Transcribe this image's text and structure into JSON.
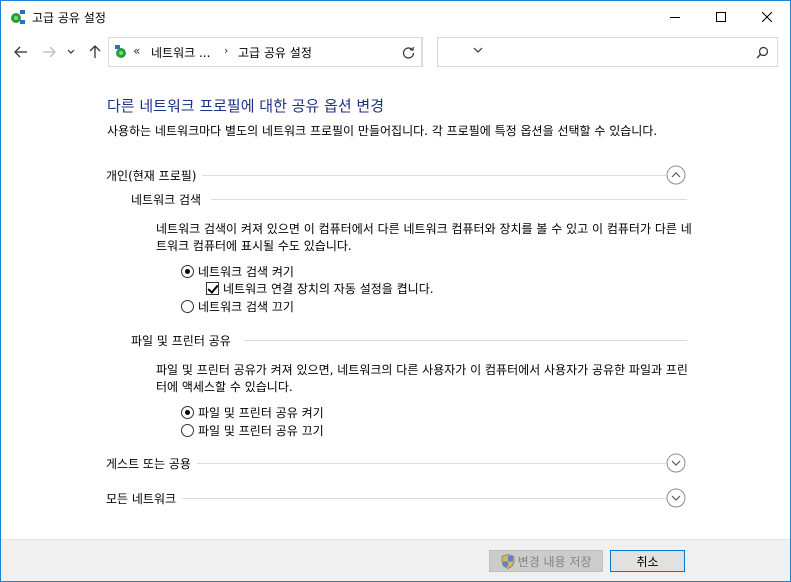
{
  "window": {
    "title": "고급 공유 설정",
    "icon": "network-sharing-icon"
  },
  "address_bar": {
    "overflow": "«",
    "segments": [
      "네트워크 ...",
      "고급 공유 설정"
    ],
    "separator": "›",
    "search_placeholder": ""
  },
  "main": {
    "heading": "다른 네트워크 프로필에 대한 공유 옵션 변경",
    "description": "사용하는 네트워크마다 별도의 네트워크 프로필이 만들어집니다. 각 프로필에 특정 옵션을 선택할 수 있습니다.",
    "private_profile": {
      "label": "개인(현재 프로필)",
      "expanded": true,
      "network_discovery": {
        "title": "네트워크 검색",
        "description": "네트워크 검색이 켜져 있으면 이 컴퓨터에서 다른 네트워크 컴퓨터와 장치를 볼 수 있고 이 컴퓨터가 다른 네트워크 컴퓨터에 표시될 수도 있습니다.",
        "option_on": "네트워크 검색 켜기",
        "option_auto": "네트워크 연결 장치의 자동 설정을 켭니다.",
        "option_off": "네트워크 검색 끄기",
        "selected": "on",
        "auto_setup_checked": true
      },
      "file_printer_sharing": {
        "title": "파일 및 프린터 공유",
        "description": "파일 및 프린터 공유가 켜져 있으면, 네트워크의 다른 사용자가 이 컴퓨터에서 사용자가 공유한 파일과 프린터에 액세스할 수 있습니다.",
        "option_on": "파일 및 프린터 공유 켜기",
        "option_off": "파일 및 프린터 공유 끄기",
        "selected": "on"
      }
    },
    "guest_profile": {
      "label": "게스트 또는 공용",
      "expanded": false
    },
    "all_networks": {
      "label": "모든 네트워크",
      "expanded": false
    }
  },
  "footer": {
    "save_label": "변경 내용 저장",
    "cancel_label": "취소"
  },
  "colors": {
    "heading": "#1e3287",
    "border": "#1883d7",
    "footer_bg": "#f0f0f0"
  }
}
